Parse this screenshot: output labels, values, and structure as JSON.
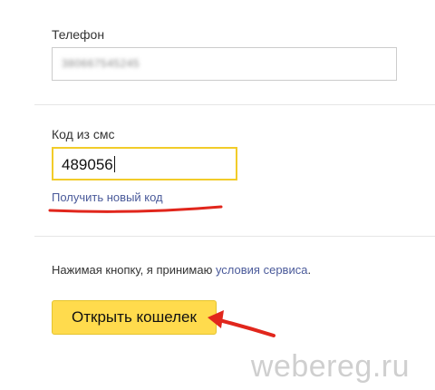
{
  "phone": {
    "label": "Телефон",
    "value": "380667545245"
  },
  "sms": {
    "label": "Код из смс",
    "value": "489056",
    "resend_link": "Получить новый код"
  },
  "terms": {
    "prefix": "Нажимая кнопку, я принимаю ",
    "link": "условия сервиса",
    "suffix": "."
  },
  "submit": {
    "label": "Открыть кошелек"
  },
  "watermark": "webereg.ru",
  "colors": {
    "accent_yellow": "#ffdb4d",
    "focus_border": "#f2cc29",
    "link": "#4a5a9a",
    "annotation_red": "#e1261c"
  }
}
